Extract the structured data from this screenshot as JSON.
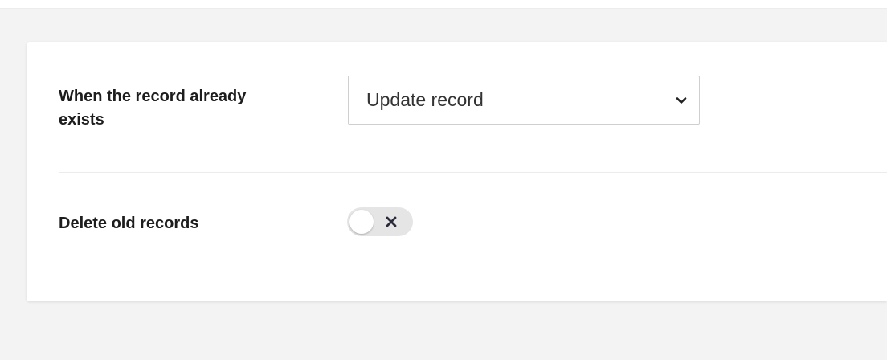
{
  "settings": {
    "existing_record": {
      "label": "When the record already exists",
      "selected_value": "Update record"
    },
    "delete_old": {
      "label": "Delete old records",
      "enabled": false
    }
  },
  "icons": {
    "dropdown": "chevron-down-icon",
    "toggle_off": "close-icon"
  },
  "colors": {
    "page_background": "#f4f3f3",
    "card_background": "#ffffff",
    "toggle_off_track": "#e6e5e6",
    "text": "#1d1d1d"
  }
}
